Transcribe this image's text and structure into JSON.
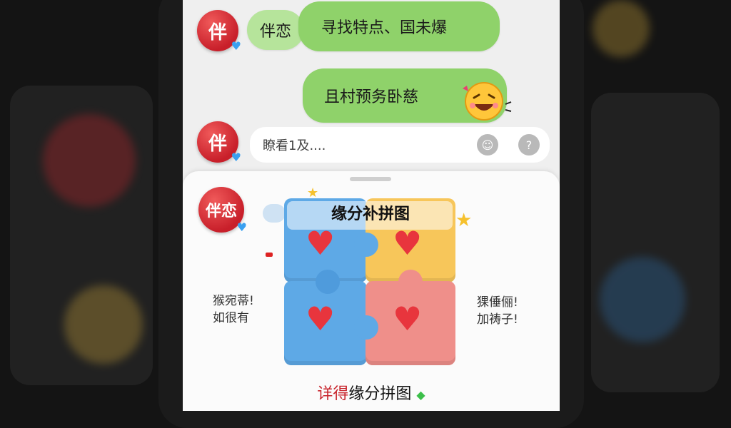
{
  "chat": {
    "avatar_label_short": "伴",
    "avatar_label_long": "伴恋",
    "message_1_sender": "伴恋",
    "message_1_text": "寻找特点、国未爆",
    "message_2_text": "且村预务卧慈",
    "input_placeholder": "瞭看1及...."
  },
  "sheet": {
    "avatar_label": "伴恋",
    "puzzle_title": "缘分补拼图",
    "left_text_line1": "猴宛蒂!",
    "left_text_line2": "如很有",
    "right_text_line1": "猓倕俪!",
    "right_text_line2": "加祷子!",
    "footer_accent": "详得",
    "footer_text": "缘分拼图"
  },
  "colors": {
    "bubble_green": "#8fd26a",
    "avatar_red": "#c81f2a",
    "piece_blue": "#5ea9e6",
    "piece_yellow": "#f7c65a",
    "piece_pink": "#ef8f8a",
    "heart_red": "#e8353d"
  },
  "icons": {
    "emoji": "laughing-emoji-icon",
    "sticker_button": "sticker-icon",
    "help_button": "question-icon",
    "star": "star-icon",
    "diamond": "diamond-icon"
  }
}
